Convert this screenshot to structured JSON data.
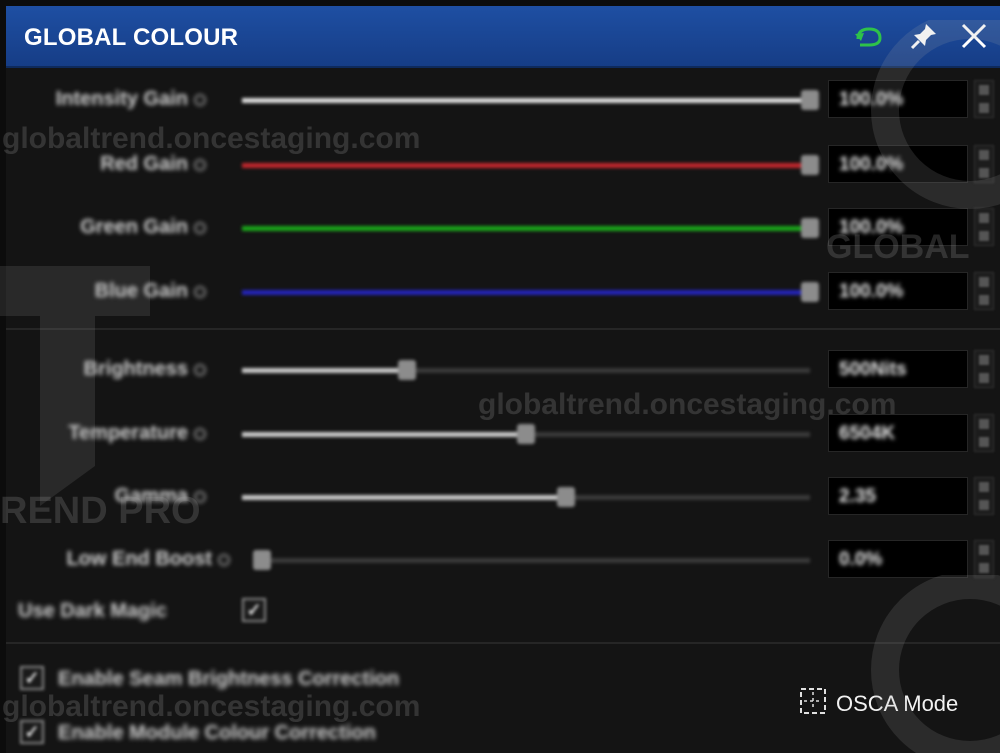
{
  "window": {
    "title": "GLOBAL COLOUR"
  },
  "titlebar_icons": [
    "refresh-icon",
    "pin-icon",
    "close-icon"
  ],
  "gains": [
    {
      "label": "Intensity Gain",
      "value": "100.0%",
      "level": 1.0,
      "color": "#dcdcdc"
    },
    {
      "label": "Red Gain",
      "value": "100.0%",
      "level": 1.0,
      "color": "#c0272d"
    },
    {
      "label": "Green Gain",
      "value": "100.0%",
      "level": 1.0,
      "color": "#1aa51a"
    },
    {
      "label": "Blue Gain",
      "value": "100.0%",
      "level": 1.0,
      "color": "#2424b8"
    }
  ],
  "adjustments": [
    {
      "label": "Brightness",
      "value": "500Nits",
      "level": 0.29,
      "color": "#c8c8c8"
    },
    {
      "label": "Temperature",
      "value": "6504K",
      "level": 0.5,
      "color": "#c8c8c8"
    },
    {
      "label": "Gamma",
      "value": "2.35",
      "level": 0.57,
      "color": "#c8c8c8"
    },
    {
      "label": "Low End Boost",
      "value": "0.0%",
      "level": 0.0,
      "color": "#c8c8c8"
    }
  ],
  "dark_magic": {
    "label": "Use Dark Magic",
    "checked": true
  },
  "options": [
    {
      "label": "Enable Seam Brightness Correction",
      "checked": true
    },
    {
      "label": "Enable Module Colour Correction",
      "checked": true
    }
  ],
  "osca": {
    "label": "OSCA Mode",
    "icon": "dashed-square-icon"
  },
  "watermarks": [
    "globaltrend.oncestaging.com",
    "globaltrend.oncestaging.com",
    "globaltrend.oncestaging.com",
    "GLOBAL",
    "REND PRO"
  ],
  "colors": {
    "titlebar": "#1e4fa3",
    "background": "#141414",
    "refresh_icon": "#2ec24a"
  }
}
